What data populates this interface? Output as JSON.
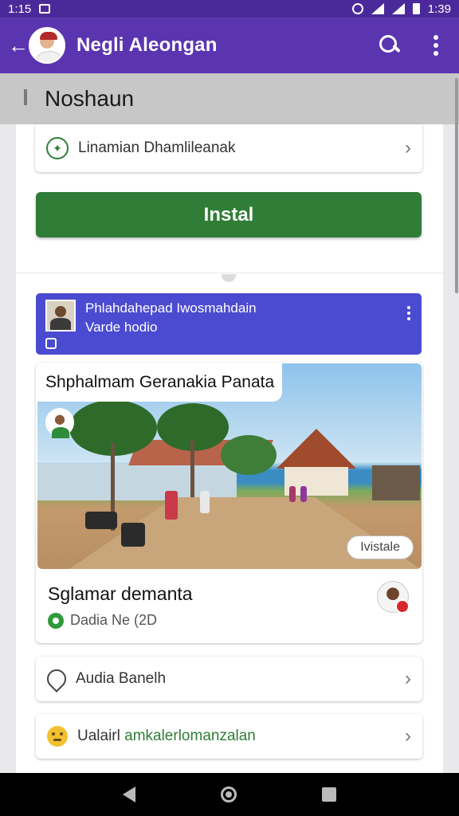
{
  "status_bar": {
    "time_left": "1:15",
    "time_right": "1:39"
  },
  "app_bar": {
    "title": "Negli Aleongan",
    "back_icon": "arrow-left-icon",
    "search_icon": "search-icon",
    "more_icon": "more-vert-icon"
  },
  "section": {
    "title": "Noshaun"
  },
  "settings_row": {
    "label": "Linamian Dhamlileanak",
    "icon": "leaf-icon"
  },
  "install_button": {
    "label": "Instal",
    "color": "#2f7d36"
  },
  "promo": {
    "line1": "Phlahdahepad Iwosmahdain",
    "line2": "Varde hodio",
    "color": "#4b4bd1"
  },
  "post": {
    "image_title": "Shphalmam Geranakia Panata",
    "badge": "Ivistale",
    "title": "Sglamar demanta",
    "meta": "Dadia Ne (2D"
  },
  "list": [
    {
      "label": "Audia Banelh",
      "icon": "pen-icon"
    },
    {
      "label_prefix": "Ualairl ",
      "label_green": "amkalerlomanzalan",
      "icon": "emoji-icon"
    }
  ],
  "colors": {
    "app_bar": "#5b35b0",
    "status_bar": "#4a2a9a",
    "accent_green": "#2f7d36"
  }
}
